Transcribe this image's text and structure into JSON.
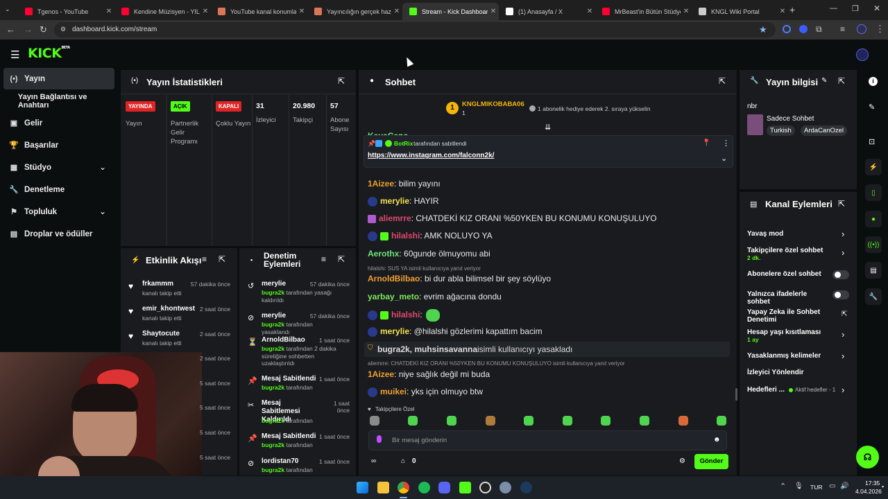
{
  "browser": {
    "tabs": [
      {
        "title": "Tgenos - YouTube",
        "icon": "youtube-icon",
        "color": "#ff0033"
      },
      {
        "title": "Kendine Müzisyen - YILLA",
        "icon": "youtube-icon",
        "color": "#ff0033"
      },
      {
        "title": "YouTube kanal konumlan",
        "icon": "ai-icon",
        "color": "#d97757"
      },
      {
        "title": "Yayıncılığın gerçek hazırlı",
        "icon": "ai-icon",
        "color": "#d97757"
      },
      {
        "title": "Stream - Kick Dashboard",
        "icon": "kick-icon",
        "color": "#53fc18"
      },
      {
        "title": "(1) Anasayfa / X",
        "icon": "x-icon",
        "color": "#ffffff"
      },
      {
        "title": "MrBeast'in Bütün Stüdyol",
        "icon": "youtube-icon",
        "color": "#ff0033"
      },
      {
        "title": "KNGL Wiki Portal",
        "icon": "globe-icon",
        "color": "#cccccc"
      }
    ],
    "url": "dashboard.kick.com/stream"
  },
  "kick": {
    "logo": "KICK",
    "logo_sup": "BETA"
  },
  "sidebar": {
    "items": [
      {
        "label": "Yayın",
        "icon": "broadcast-icon"
      },
      {
        "label": "Yayın Bağlantısı ve Anahtarı",
        "icon": ""
      },
      {
        "label": "Gelir",
        "icon": "wallet-icon"
      },
      {
        "label": "Başarılar",
        "icon": "trophy-icon"
      },
      {
        "label": "Stüdyo",
        "icon": "studio-icon"
      },
      {
        "label": "Denetleme",
        "icon": "wrench-icon"
      },
      {
        "label": "Topluluk",
        "icon": "community-icon"
      },
      {
        "label": "Droplar ve ödüller",
        "icon": "gift-icon"
      }
    ]
  },
  "stats": {
    "title": "Yayın İstatistikleri",
    "cols": [
      {
        "badge": "YAYINDA",
        "label": "Yayın",
        "badge_color": "#e02424"
      },
      {
        "badge": "AÇIK",
        "label": "Partnerlik Gelir Programı",
        "badge_color": "#53fc18"
      },
      {
        "badge": "KAPALI",
        "label": "Çoklu Yayın",
        "badge_color": "#e02424"
      },
      {
        "value": "31",
        "label": "İzleyici"
      },
      {
        "value": "20.980",
        "label": "Takipçi"
      },
      {
        "value": "57",
        "label": "Abone Sayısı"
      }
    ]
  },
  "activity": {
    "title": "Etkinlik Akışı",
    "items": [
      {
        "name": "frkammm",
        "sub": "kanalı takip etti",
        "time": "57 dakika önce"
      },
      {
        "name": "emir_khontwest",
        "sub": "kanalı takip etti",
        "time": "2 saat önce"
      },
      {
        "name": "Shaytocute",
        "sub": "kanalı takip etti",
        "time": "2 saat önce"
      }
    ],
    "more_times": [
      "2 saat önce",
      "5 saat önce",
      "5 saat önce",
      "5 saat önce",
      "5 saat önce"
    ]
  },
  "moderation": {
    "title": "Denetim Eylemleri",
    "items": [
      {
        "name": "merylie",
        "by": "bugra2k",
        "desc": "tarafından yasağı kaldırıldı",
        "time": "57 dakika önce"
      },
      {
        "name": "merylie",
        "by": "bugra2k",
        "desc": "tarafından yasaklandı",
        "time": "57 dakika önce"
      },
      {
        "name": "ArnoldBilbao",
        "by": "bugra2k",
        "desc": "tarafından 2 dakika süreliğine sohbetten uzaklaştırıldı",
        "time": "1 saat önce"
      },
      {
        "name": "Mesaj Sabitlendi",
        "by": "bugra2k",
        "desc": "tarafından",
        "time": "1 saat önce"
      },
      {
        "name": "Mesaj Sabitlemesi Kaldırıldı",
        "by": "bugra2k",
        "desc": "tarafından",
        "time": "1 saat önce"
      },
      {
        "name": "Mesaj Sabitlendi",
        "by": "bugra2k",
        "desc": "tarafından",
        "time": "1 saat önce"
      },
      {
        "name": "lordistan70",
        "by": "bugra2k",
        "desc": "tarafından",
        "time": "1 saat önce"
      }
    ]
  },
  "chat": {
    "title": "Sohbet",
    "gift_user": "KNGLMIKOBABA06",
    "gift_count": "1",
    "gift_text": "1 abonelik hediye ederek 2. sıraya yükselin",
    "partial_user": "KayaCenc",
    "pinned_by": "BotRix",
    "pinned_by_text": "tarafından sabitlendi",
    "pinned_link": "https://www.instagram.com/falconn2k/",
    "messages": [
      {
        "user": "1Aizee",
        "color": "#f0a030",
        "text": "bilim yayını"
      },
      {
        "user": "merylie",
        "color": "#f5e04f",
        "text": "HAYIR"
      },
      {
        "user": "aliemrre",
        "color": "#e0486e",
        "text": "CHATDEKİ KIZ ORANI %50YKEN BU KONUMU KONUŞULUYO"
      },
      {
        "user": "hilalshi",
        "color": "#e0486e",
        "text": "AMK NOLUYO YA"
      },
      {
        "user": "Aerothx",
        "color": "#6ee77a",
        "text": "60gunde ölmuyomu abi"
      },
      {
        "user": "ArnoldBilbao",
        "color": "#f0a030",
        "text": "bi dur abla bilimsel bir şey söylüyo"
      },
      {
        "user": "yarbay_meto",
        "color": "#7ee65a",
        "text": "evrim ağacına dondu"
      },
      {
        "user": "hilalshi",
        "color": "#e0486e",
        "text": ""
      },
      {
        "user": "merylie",
        "color": "#f5e04f",
        "text": "@hilalshi gözlerimi kapattım bacim"
      },
      {
        "user": "1Aizee",
        "color": "#f0a030",
        "text": "niye sağlık değil mi buda"
      },
      {
        "user": "muikei",
        "color": "#f0a030",
        "text": "yks için olmuyo btw"
      }
    ],
    "reply1": "hilalshi: SUS YA isimli kullanıcıya yanıt veriyor",
    "ban_users": "bugra2k, muhsinsavanna",
    "ban_text": "isimli kullanıcıyı yasakladı",
    "reply2": "aliemrre: CHATDEKİ KIZ ORANI %50YKEN BU KONUMU KONUŞULUYO isimli kullanıcıya yanıt veriyor",
    "followers_only": "Takipçilere Özel",
    "input_placeholder": "Bir mesaj gönderin",
    "points": "0",
    "send_label": "Gönder"
  },
  "streaminfo": {
    "title": "Yayın bilgisi",
    "nbr": "nbr",
    "category": "Sadece Sohbet",
    "tags": [
      "Turkish",
      "ArdaCanOzel"
    ]
  },
  "channel_actions": {
    "title": "Kanal Eylemleri",
    "items": [
      {
        "label": "Yavaş mod",
        "sub": "",
        "control": "chevron"
      },
      {
        "label": "Takipçilere özel sohbet",
        "sub": "2 dk.",
        "control": "chevron"
      },
      {
        "label": "Abonelere özel sohbet",
        "sub": "",
        "control": "toggle"
      },
      {
        "label": "Yalnızca ifadelerle sohbet",
        "sub": "",
        "control": "toggle"
      },
      {
        "label": "Yapay Zeka ile Sohbet Denetimi",
        "sub": "",
        "control": "external"
      },
      {
        "label": "Hesap yaşı kısıtlaması",
        "sub": "1 ay",
        "control": "chevron"
      },
      {
        "label": "Yasaklanmış kelimeler",
        "sub": "",
        "control": "chevron"
      },
      {
        "label": "İzleyici Yönlendir",
        "sub": "",
        "control": "none"
      },
      {
        "label": "Hedefleri ...",
        "sub": "Aktif hedefler - 1",
        "control": "chevron"
      }
    ]
  },
  "taskbar": {
    "lang": "TUR",
    "time": "17:35",
    "date": "4.04.2026"
  }
}
